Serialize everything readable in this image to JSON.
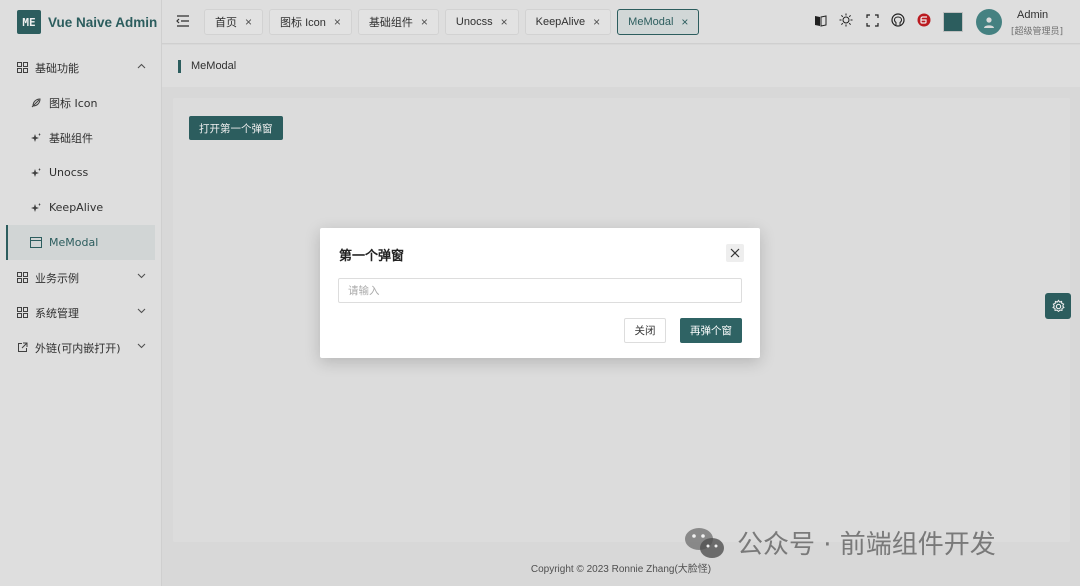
{
  "app": {
    "logo_text": "ME",
    "title": "Vue Naive Admin"
  },
  "sidebar": {
    "items": [
      {
        "label": "基础功能",
        "icon": "grid-icon",
        "expanded": true
      },
      {
        "label": "图标 Icon",
        "icon": "feather-icon"
      },
      {
        "label": "基础组件",
        "icon": "sparkle-icon"
      },
      {
        "label": "Unocss",
        "icon": "sparkle-icon"
      },
      {
        "label": "KeepAlive",
        "icon": "sparkle-icon"
      },
      {
        "label": "MeModal",
        "icon": "window-icon",
        "active": true
      },
      {
        "label": "业务示例",
        "icon": "grid-icon"
      },
      {
        "label": "系统管理",
        "icon": "grid-icon"
      },
      {
        "label": "外链(可内嵌打开)",
        "icon": "external-link-icon"
      }
    ]
  },
  "tabs": [
    {
      "label": "首页"
    },
    {
      "label": "图标 Icon"
    },
    {
      "label": "基础组件"
    },
    {
      "label": "Unocss"
    },
    {
      "label": "KeepAlive"
    },
    {
      "label": "MeModal",
      "active": true
    }
  ],
  "user": {
    "name": "Admin",
    "role": "[超级管理员]"
  },
  "theme": {
    "accent": "#2f6364"
  },
  "breadcrumb": {
    "current": "MeModal"
  },
  "content": {
    "open_button_label": "打开第一个弹窗"
  },
  "modal": {
    "title": "第一个弹窗",
    "input_placeholder": "请输入",
    "input_value": "",
    "close_label": "关闭",
    "again_label": "再弹个窗"
  },
  "footer": {
    "copyright": "Copyright © 2023 Ronnie Zhang(大脸怪)"
  },
  "watermark": {
    "text": "公众号 · 前端组件开发"
  }
}
